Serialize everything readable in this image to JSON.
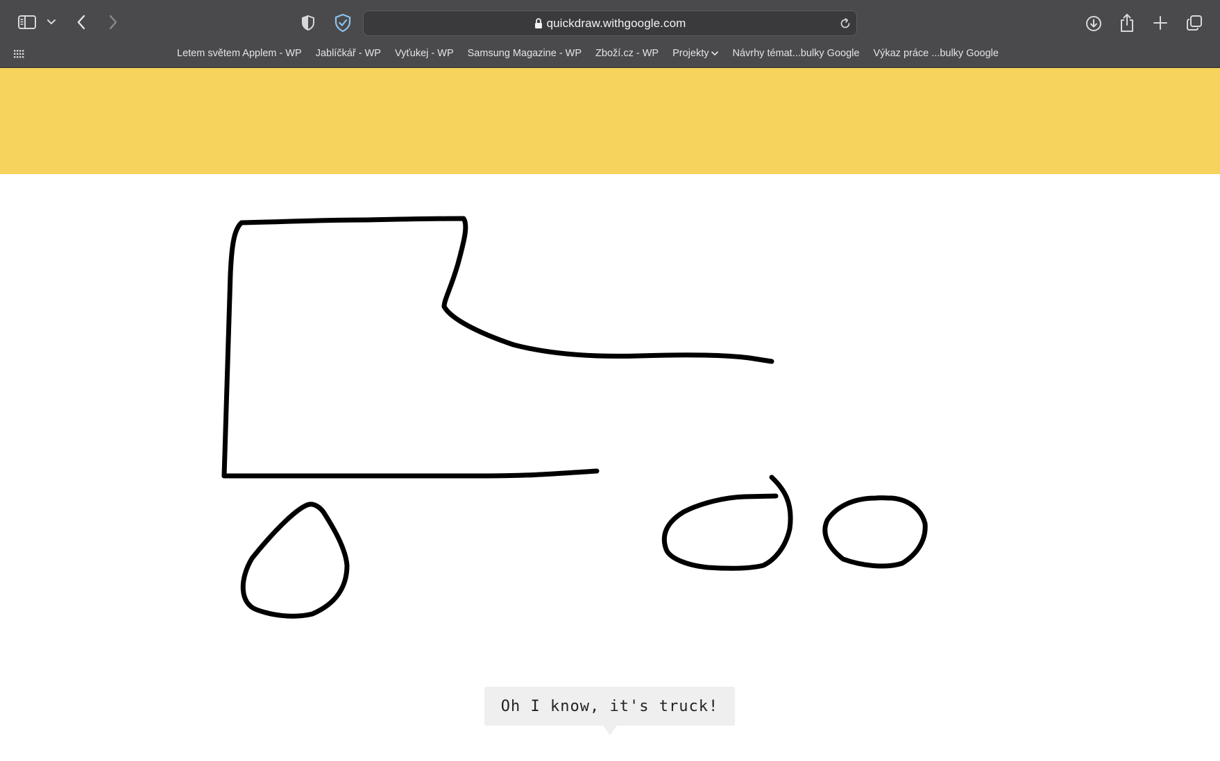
{
  "browser": {
    "url": "quickdraw.withgoogle.com",
    "toolbar_icons": {
      "sidebar": "sidebar-icon",
      "sidebar_menu": "chevron-down-icon",
      "back": "back-icon",
      "forward": "forward-icon",
      "privacy": "shield-icon",
      "extension": "shield-check-icon",
      "lock": "lock-icon",
      "reload": "reload-icon",
      "downloads": "download-icon",
      "share": "share-icon",
      "new_tab": "plus-icon",
      "tabs_overview": "tabs-overview-icon",
      "favorites": "grid-icon"
    },
    "bookmarks": [
      {
        "label": "Letem světem Applem - WP"
      },
      {
        "label": "Jablíčkář - WP"
      },
      {
        "label": "Vyťukej - WP"
      },
      {
        "label": "Samsung Magazine - WP"
      },
      {
        "label": "Zboží.cz - WP"
      },
      {
        "label": "Projekty"
      },
      {
        "label": "Návrhy témat...bulky Google"
      },
      {
        "label": "Výkaz práce ...bulky Google"
      }
    ]
  },
  "page": {
    "banner_color": "#f6d35c",
    "drawing_subject": "truck",
    "speech_bubble": {
      "text": "Oh I know, it's truck!"
    }
  }
}
